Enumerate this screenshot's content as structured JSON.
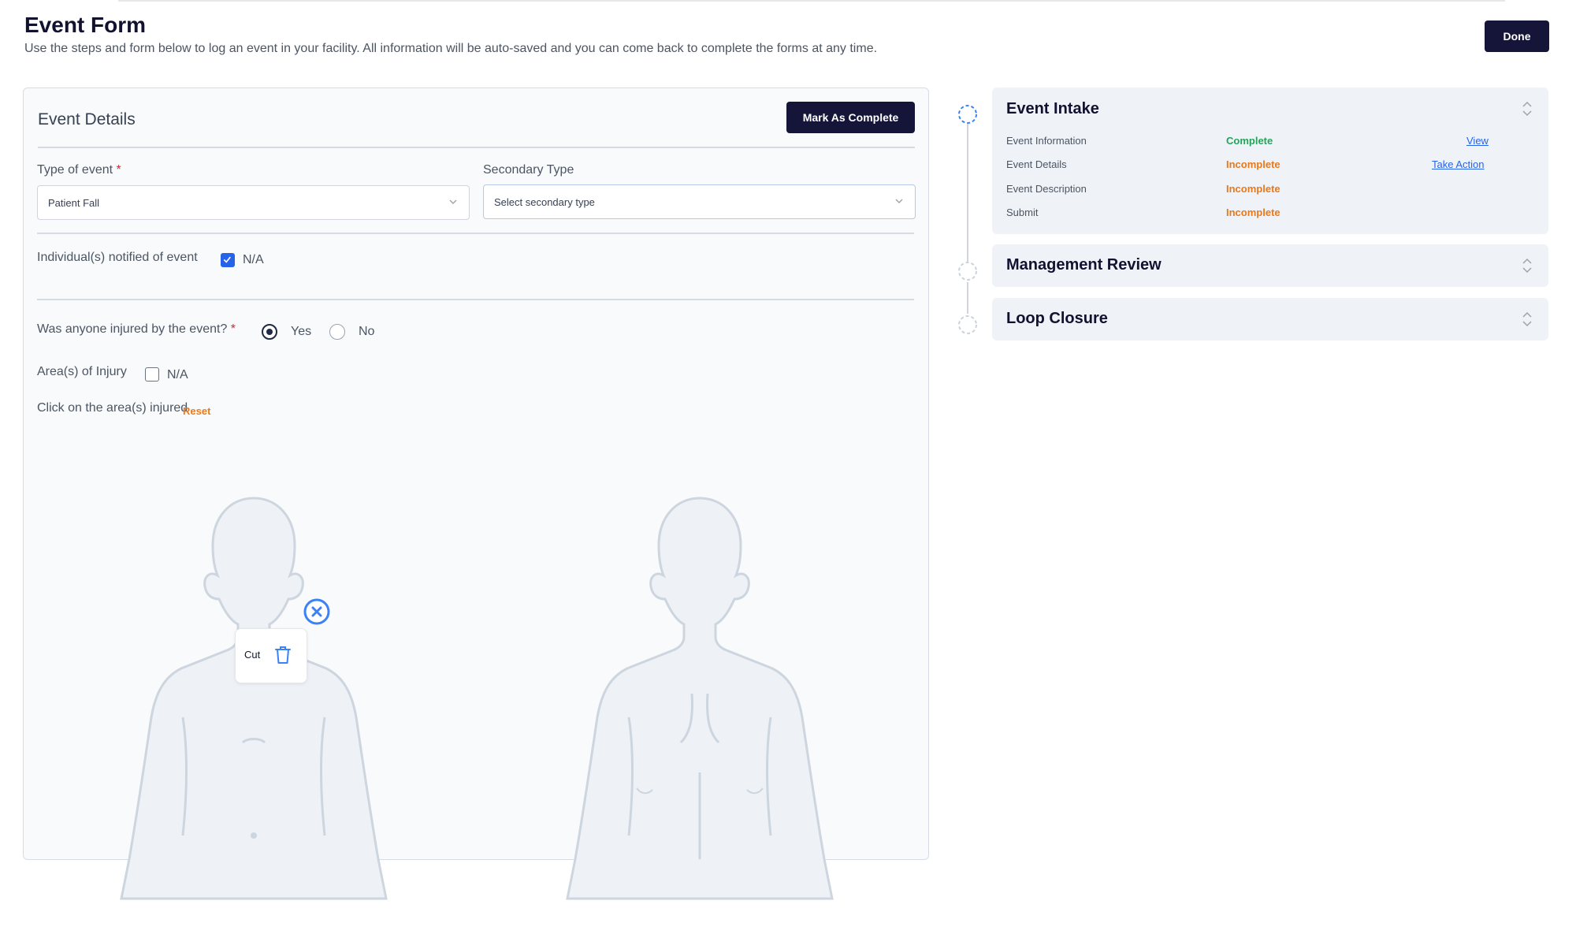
{
  "header": {
    "title": "Event Form",
    "subtitle": "Use the steps and form below to log an event in your facility. All information will be auto-saved and you can come back to complete the forms at any time.",
    "done_label": "Done"
  },
  "details": {
    "title": "Event Details",
    "mark_complete_label": "Mark As Complete",
    "type_label": "Type of event",
    "type_required": "*",
    "type_value": "Patient Fall",
    "secondary_label": "Secondary Type",
    "secondary_placeholder": "Select secondary type",
    "notified_label": "Individual(s) notified of event",
    "notified_na_label": "N/A",
    "notified_na_checked": true,
    "injured_label": "Was anyone injured by the event?",
    "injured_required": "*",
    "injured_yes": "Yes",
    "injured_no": "No",
    "injured_selected": "Yes",
    "areas_label": "Area(s) of Injury",
    "areas_na_label": "N/A",
    "areas_na_checked": false,
    "click_label": "Click on the area(s) injured",
    "reset_label": "Reset",
    "marker_tooltip": "Cut"
  },
  "steps": [
    {
      "title": "Event Intake",
      "expanded": true,
      "rows": [
        {
          "label": "Event Information",
          "status": "Complete",
          "action": "View"
        },
        {
          "label": "Event Details",
          "status": "Incomplete",
          "action": "Take Action"
        },
        {
          "label": "Event Description",
          "status": "Incomplete",
          "action": ""
        },
        {
          "label": "Submit",
          "status": "Incomplete",
          "action": ""
        }
      ]
    },
    {
      "title": "Management Review",
      "expanded": false
    },
    {
      "title": "Loop Closure",
      "expanded": false
    }
  ],
  "colors": {
    "primary": "#141539",
    "complete": "#22a559",
    "incomplete": "#e8791b",
    "link": "#2563eb",
    "required": "#dc2626",
    "checkbox": "#2563eb"
  },
  "icons": [
    "chevron-down-icon",
    "checkmark-icon",
    "close-circle-icon",
    "trash-icon",
    "expand-collapse-icon",
    "step-circle-icon"
  ]
}
